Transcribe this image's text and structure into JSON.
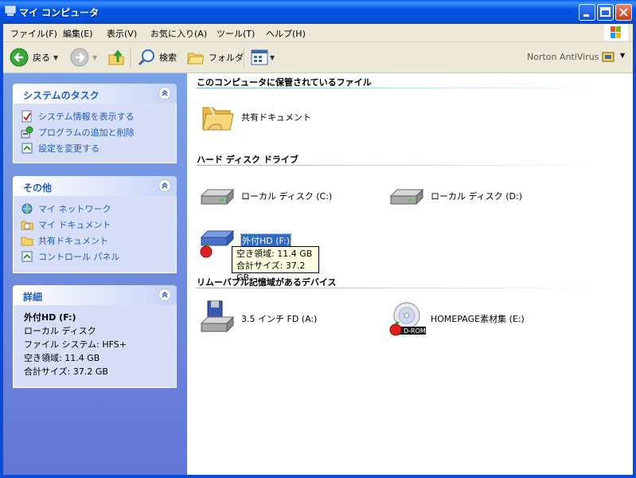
{
  "window": {
    "title": "マイ コンピュータ"
  },
  "menu": [
    "ファイル(F)",
    "編集(E)",
    "表示(V)",
    "お気に入り(A)",
    "ツール(T)",
    "ヘルプ(H)"
  ],
  "toolbar": {
    "back_label": "戻る",
    "search_label": "検索",
    "folders_label": "フォルダ",
    "norton_label": "Norton AntiVirus"
  },
  "left": {
    "system_tasks": {
      "title": "システムのタスク",
      "items": [
        "システム情報を表示する",
        "プログラムの追加と削除",
        "設定を変更する"
      ]
    },
    "other_places": {
      "title": "その他",
      "items": [
        "マイ ネットワーク",
        "マイ ドキュメント",
        "共有ドキュメント",
        "コントロール パネル"
      ]
    },
    "details": {
      "title": "詳細",
      "name": "外付HD (F:)",
      "type": "ローカル ディスク",
      "filesystem": "ファイル システム: HFS+",
      "free": "空き領域: 11.4 GB",
      "total": "合計サイズ: 37.2 GB"
    }
  },
  "right": {
    "groups": {
      "stored": "このコンピュータに保管されているファイル",
      "hdd": "ハード ディスク ドライブ",
      "removable": "リムーバブル記憶域があるデバイス"
    },
    "items": {
      "shared_docs": "共有ドキュメント",
      "disk_c": "ローカル ディスク (C:)",
      "disk_d": "ローカル ディスク (D:)",
      "disk_f": "外付HD (F:)",
      "floppy": "3.5 インチ FD (A:)",
      "cdrom": "HOMEPAGE素材集 (E:)",
      "cd_badge": "D-ROM"
    },
    "tooltip": {
      "line1": "空き領域: 11.4 GB",
      "line2": "合計サイズ: 37.2 GB"
    }
  }
}
